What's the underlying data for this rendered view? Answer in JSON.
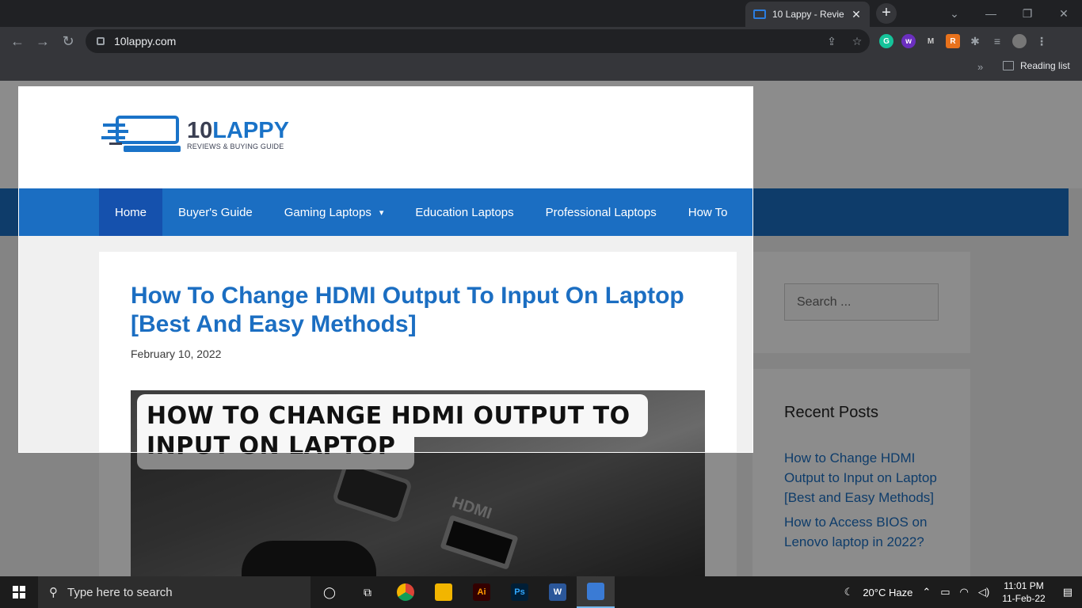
{
  "browser": {
    "tab_title": "10 Lappy - Revie",
    "url": "10lappy.com",
    "reading_list": "Reading list"
  },
  "site": {
    "logo_main_1": "10",
    "logo_main_2": "LAPPY",
    "logo_sub": "REVIEWS & BUYING GUIDE",
    "nav": [
      "Home",
      "Buyer's Guide",
      "Gaming Laptops",
      "Education Laptops",
      "Professional Laptops",
      "How To"
    ]
  },
  "post": {
    "title": "How To Change HDMI Output To Input On Laptop [Best And Easy Methods]",
    "date": "February 10, 2022",
    "image_heading": "HOW TO CHANGE HDMI OUTPUT TO INPUT ON LAPTOP",
    "image_port_label": "HDMI"
  },
  "sidebar": {
    "search_placeholder": "Search ...",
    "recent_title": "Recent Posts",
    "recent": [
      "How to Change HDMI Output to Input on Laptop [Best and Easy Methods]",
      "How to Access BIOS on Lenovo laptop in 2022?"
    ]
  },
  "taskbar": {
    "search_placeholder": "Type here to search",
    "weather": "20°C  Haze",
    "time": "11:01 PM",
    "date": "11-Feb-22"
  },
  "colors": {
    "brand_blue": "#1b6ec2",
    "nav_active": "#1551ad"
  }
}
